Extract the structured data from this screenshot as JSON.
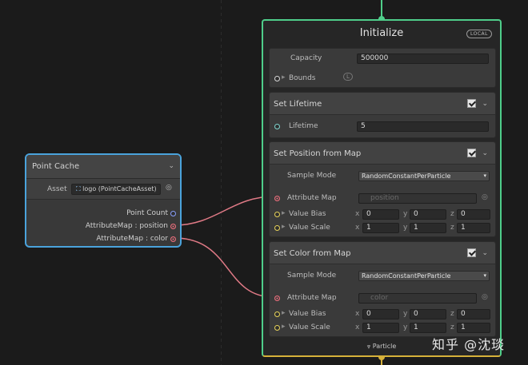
{
  "point_cache": {
    "title": "Point Cache",
    "asset_label": "Asset",
    "asset_value": "logo (PointCacheAsset)",
    "outputs": [
      "Point Count",
      "AttributeMap : position",
      "AttributeMap : color"
    ]
  },
  "initialize": {
    "title": "Initialize",
    "badge": "LOCAL",
    "capacity_label": "Capacity",
    "capacity_value": "500000",
    "bounds_label": "Bounds",
    "footer_label": "Particle"
  },
  "set_lifetime": {
    "title": "Set Lifetime",
    "lifetime_label": "Lifetime",
    "lifetime_value": "5"
  },
  "set_position": {
    "title": "Set Position from Map",
    "sample_mode_label": "Sample Mode",
    "sample_mode_value": "RandomConstantPerParticle",
    "attribute_map_label": "Attribute Map",
    "attribute_map_value": "position",
    "value_bias_label": "Value Bias",
    "value_bias": {
      "x": "0",
      "y": "0",
      "z": "0"
    },
    "value_scale_label": "Value Scale",
    "value_scale": {
      "x": "1",
      "y": "1",
      "z": "1"
    }
  },
  "set_color": {
    "title": "Set Color from Map",
    "sample_mode_label": "Sample Mode",
    "sample_mode_value": "RandomConstantPerParticle",
    "attribute_map_label": "Attribute Map",
    "attribute_map_value": "color",
    "value_bias_label": "Value Bias",
    "value_bias": {
      "x": "0",
      "y": "0",
      "z": "0"
    },
    "value_scale_label": "Value Scale",
    "value_scale": {
      "x": "1",
      "y": "1",
      "z": "1"
    }
  },
  "axes": {
    "x": "x",
    "y": "y",
    "z": "z"
  },
  "watermark": "知乎 @沈琰",
  "colors": {
    "context_border": "#4fce8a",
    "context_bottom": "#d6b13a",
    "node_border": "#4aa3dc",
    "wire": "#e07a86"
  }
}
